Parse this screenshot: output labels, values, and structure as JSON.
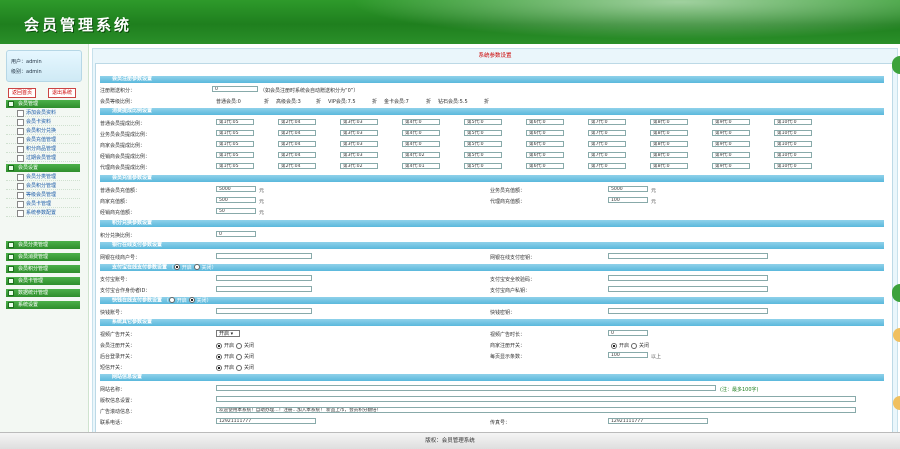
{
  "app": {
    "title": "会员管理系统",
    "footer": "版权：会员管理系统"
  },
  "colors": {
    "brand": "#2e9a2b",
    "section": "#5ab8dc",
    "title_red": "#cc0000"
  },
  "sidebar": {
    "user_line1": "用户：admin",
    "user_line2": "级别：admin",
    "btn_left": "返回首页",
    "btn_right": "退出系统",
    "heads": [
      {
        "label": "会员管理"
      },
      {
        "label": "会员设置"
      },
      {
        "label": "会员分类管理"
      },
      {
        "label": "会员消费管理"
      },
      {
        "label": "会员积分管理"
      },
      {
        "label": "会员卡管理"
      },
      {
        "label": "数据统计管理"
      },
      {
        "label": "系统设置"
      }
    ],
    "items_a": [
      "添加会员资料",
      "会员卡资料",
      "会员积分兑换",
      "会员充值管理",
      "积分商品管理",
      "过期会员管理"
    ],
    "items_b": [
      "会员分类管理",
      "会员积分管理",
      "等级会员管理",
      "会员卡管理",
      "系统参数配置"
    ]
  },
  "main": {
    "page_title": "系统参数设置",
    "s1": {
      "title": "会员注册参数设置",
      "r1_label": "注册赠送积分：",
      "r1_value": "0",
      "r1_note": "（如会员注册时系统会自动赠送积分为“0”）",
      "r2_label": "会员等级比例：",
      "levels": [
        {
          "label": "普通会员:0",
          "unit": "折"
        },
        {
          "label": "高级会员:3",
          "unit": "折"
        },
        {
          "label": "VIP会员:7.5",
          "unit": "折"
        },
        {
          "label": "金卡会员:7",
          "unit": "折"
        },
        {
          "label": "钻石会员:5.5",
          "unit": "折"
        }
      ]
    },
    "s2": {
      "title": "消费提成比例设置",
      "rows": [
        {
          "label": "普通会员提成比例：",
          "cells": [
            "第1代:05",
            "第2代:04",
            "第3代:03",
            "第4代:0",
            "第5代:0",
            "第6代:0",
            "第7代:0",
            "第8代:0",
            "第9代:0",
            "第10代:0"
          ]
        },
        {
          "label": "业务员会员提成比例：",
          "cells": [
            "第1代:05",
            "第2代:04",
            "第3代:03",
            "第4代:0",
            "第5代:0",
            "第6代:0",
            "第7代:0",
            "第8代:0",
            "第9代:0",
            "第10代:0"
          ]
        },
        {
          "label": "商家会员提成比例：",
          "cells": [
            "第1代:05",
            "第2代:04",
            "第3代:03",
            "第4代:0",
            "第5代:0",
            "第6代:0",
            "第7代:0",
            "第8代:0",
            "第9代:0",
            "第10代:0"
          ]
        },
        {
          "label": "经销商会员提成比例：",
          "cells": [
            "第1代:05",
            "第2代:04",
            "第3代:03",
            "第4代:02",
            "第5代:0",
            "第6代:0",
            "第7代:0",
            "第8代:0",
            "第9代:0",
            "第10代:0"
          ]
        },
        {
          "label": "代理商会员提成比例：",
          "cells": [
            "第1代:05",
            "第2代:04",
            "第3代:02",
            "第4代:01",
            "第5代:0",
            "第6代:0",
            "第7代:0",
            "第8代:0",
            "第9代:0",
            "第10代:0"
          ]
        }
      ]
    },
    "s3": {
      "title": "会员充值参数设置",
      "left": [
        {
          "label": "普通会员充值额：",
          "value": "5000",
          "unit": "元"
        },
        {
          "label": "商家充值额：",
          "value": "500",
          "unit": "元"
        },
        {
          "label": "经销商充值额：",
          "value": "50",
          "unit": "元"
        }
      ],
      "right": [
        {
          "label": "业务员充值额：",
          "value": "5000",
          "unit": "元"
        },
        {
          "label": "代理商充值额：",
          "value": "100",
          "unit": "元"
        }
      ]
    },
    "s4": {
      "title": "积分兑换参数设置",
      "label": "积分兑换比例：",
      "value": "0"
    },
    "s5": {
      "title": "银行在线支付参数设置",
      "l_label": "网银在线商户号：",
      "r_label": "网银在线支付密钥："
    },
    "s6": {
      "title": "支付宝在线支付参数设置",
      "opt_on": "开启",
      "opt_off": "关闭",
      "l1": "支付宝账号：",
      "r1": "支付宝安全校验码：",
      "l2": "支付宝合作身份者ID：",
      "r2": "支付宝商户私钥："
    },
    "s7": {
      "title": "快钱在线支付参数设置",
      "opt_on": "开启",
      "opt_off": "关闭",
      "l1": "快钱账号：",
      "r1": "快钱密钥："
    },
    "s8": {
      "title": "系统其它参数设置",
      "l1": "视频广告开关：",
      "l1_select": "开启",
      "r1": "视频广告时长：",
      "r1_value": "0",
      "l2": "会员注册开关：",
      "r2": "商家注册开关：",
      "l3": "后台登录开关：",
      "r3": "每页显示条数：",
      "r3_value": "100",
      "r3_unit": "以上",
      "l4": "短信开关：",
      "opt_on": "开启",
      "opt_off": "关闭"
    },
    "s9": {
      "title": "网站信息设置",
      "l1": "网站名称：",
      "l1_hint": "(注：最多100字)",
      "l2": "版权信息设置：",
      "l3": "广告滚动信息：",
      "l3_value": "欢迎使用本系统！自助办理…！注册…加入本系统！ 新品上市，会员积分翻倍！",
      "l4": "联系电话：",
      "l4_value": "12921111777",
      "r4": "传真号：",
      "r4_value": "12921111777"
    }
  }
}
